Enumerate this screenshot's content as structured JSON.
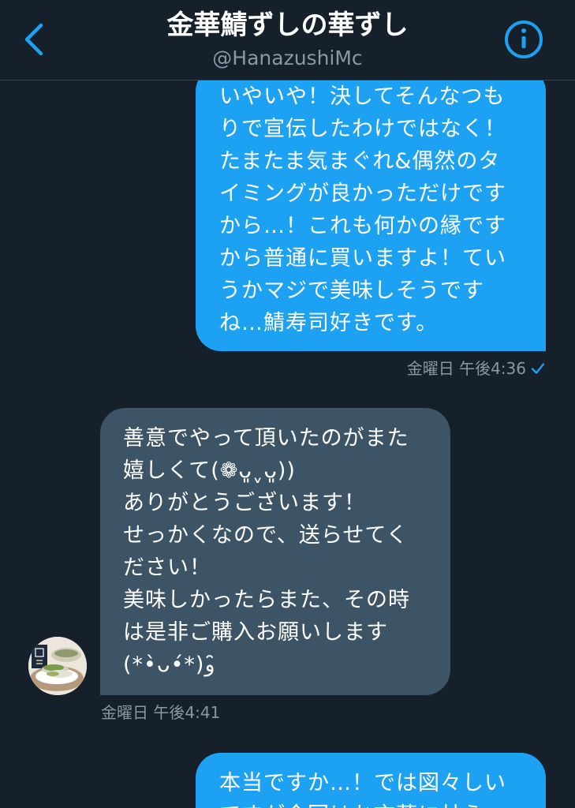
{
  "header": {
    "title": "金華鯖ずしの華ずし",
    "handle": "@HanazushiMc",
    "back_icon": "chevron-left-icon",
    "info_icon": "info-circle-icon",
    "accent_color": "#1da1f2"
  },
  "messages": [
    {
      "direction": "sent",
      "text": "いやいや！決してそんなつも\nりで宣伝したわけではなく！\nたまたま気まぐれ&偶然のタ\nイミングが良かっただけです\nから…！これも何かの縁です\nから普通に買いますよ！てい\nうかマジで美味しそうです\nね…鯖寿司好きです。",
      "timestamp": "金曜日 午後4:36",
      "status_icon": "check-icon"
    },
    {
      "direction": "received",
      "text": "善意でやって頂いたのがまた\n嬉しくて(❁ᴗ͈ˬᴗ͈))\nありがとうございます！\nせっかくなので、送らせてく\nださい！\n美味しかったらまた、その時\nは是非ご購入お願いします\n(*•̀ᴗ•́*)و ̑̑",
      "timestamp": "金曜日 午後4:41",
      "avatar": "sushi-avatar"
    },
    {
      "direction": "sent",
      "text": "本当ですか…！では図々しい\nですが今回はお言葉に甘え"
    }
  ],
  "colors": {
    "background": "#15202b",
    "sent_bubble": "#1da1f2",
    "received_bubble": "#3d5466",
    "meta_text": "#8899a6",
    "divider": "#38444d"
  }
}
